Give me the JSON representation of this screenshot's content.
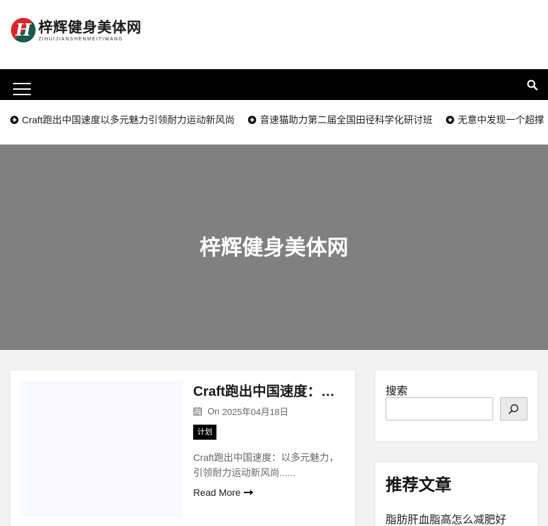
{
  "header": {
    "logo_mark": "H",
    "logo_cn": "梓辉健身美体网",
    "logo_en": "ZIHUIJIANSHENMEITIWANG"
  },
  "nav": {
    "menu_icon": "hamburger-menu-icon",
    "search_icon": "search-icon"
  },
  "ticker": {
    "items": [
      {
        "label": "Craft跑出中国速度以多元魅力引领耐力运动新风尚",
        "icon": "arrow-circle-right-icon"
      },
      {
        "label": "音速猫助力第二届全国田径科学化研讨班",
        "icon": "arrow-circle-right-icon"
      },
      {
        "label": "无意中发现一个超撑",
        "icon": "arrow-circle-right-icon"
      }
    ]
  },
  "hero": {
    "title": "梓辉健身美体网",
    "background": "#808080"
  },
  "post": {
    "title": "Craft跑出中国速度：以多元魅力引领耐力运动新风尚",
    "meta_prefix": "On",
    "date": "2025年04月18日",
    "category": "计划",
    "excerpt": "Craft跑出中国速度：以多元魅力，引领耐力运动新风尚......",
    "read_more": "Read More"
  },
  "sidebar": {
    "search": {
      "label": "搜索",
      "value": "",
      "button_icon": "search-icon"
    },
    "recent": {
      "title": "推荐文章",
      "items": [
        "脂肪肝血脂高怎么减肥好"
      ]
    }
  },
  "colors": {
    "nav_bg": "#000000",
    "hero_bg": "#808080",
    "logo_red": "#d7262d",
    "logo_green": "#1a5a4e",
    "thumb_bg": "#f8f8ff"
  }
}
